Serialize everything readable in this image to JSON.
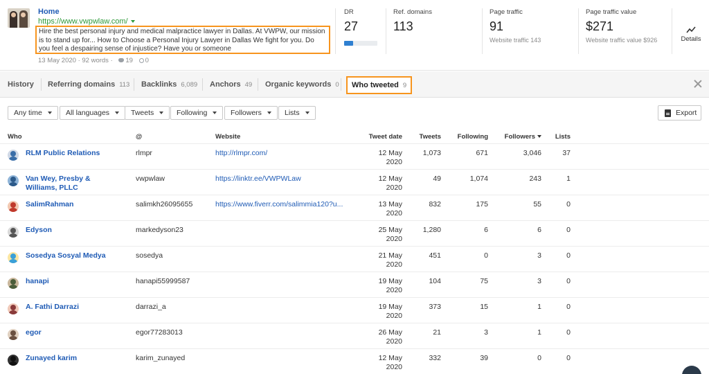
{
  "header": {
    "title": "Home",
    "url": "https://www.vwpwlaw.com/",
    "description": "Hire the best personal injury and medical malpractice lawyer in Dallas. At VWPW, our mission is to stand up for... How to Choose a Personal Injury Lawyer in Dallas We fight for you. Do you feel a despairing sense of injustice? Have you or someone",
    "date": "13 May 2020",
    "words": "· 92 words ·",
    "twitter_count": "19",
    "pinterest_count": "0"
  },
  "metrics": {
    "dr": {
      "label": "DR",
      "value": "27",
      "fill_fraction": 0.27
    },
    "ref_domains": {
      "label": "Ref. domains",
      "value": "113"
    },
    "page_traffic": {
      "label": "Page traffic",
      "value": "91",
      "sub": "Website traffic 143"
    },
    "page_traffic_value": {
      "label": "Page traffic value",
      "value": "$271",
      "sub": "Website traffic value $926"
    },
    "details_label": "Details"
  },
  "tabs": [
    {
      "label": "History",
      "count": ""
    },
    {
      "label": "Referring domains",
      "count": "113"
    },
    {
      "label": "Backlinks",
      "count": "6,089"
    },
    {
      "label": "Anchors",
      "count": "49"
    },
    {
      "label": "Organic keywords",
      "count": "0"
    },
    {
      "label": "Who tweeted",
      "count": "9"
    }
  ],
  "filters": [
    "Any time",
    "All languages",
    "Tweets",
    "Following",
    "Followers",
    "Lists"
  ],
  "export_label": "Export",
  "table": {
    "columns": [
      "Who",
      "@",
      "Website",
      "Tweet date",
      "Tweets",
      "Following",
      "Followers",
      "Lists"
    ],
    "rows": [
      {
        "who": "RLM Public Relations",
        "handle": "rlmpr",
        "website": "http://rlmpr.com/",
        "date1": "12 May",
        "date2": "2020",
        "tweets": "1,073",
        "following": "671",
        "followers": "3,046",
        "lists": "37"
      },
      {
        "who": "Van Wey, Presby & Williams, PLLC",
        "handle": "vwpwlaw",
        "website": "https://linktr.ee/VWPWLaw",
        "date1": "12 May",
        "date2": "2020",
        "tweets": "49",
        "following": "1,074",
        "followers": "243",
        "lists": "1"
      },
      {
        "who": "SalimRahman",
        "handle": "salimkh26095655",
        "website": "https://www.fiverr.com/salimmia120?u...",
        "date1": "13 May",
        "date2": "2020",
        "tweets": "832",
        "following": "175",
        "followers": "55",
        "lists": "0"
      },
      {
        "who": "Edyson",
        "handle": "markedyson23",
        "website": "",
        "date1": "25 May",
        "date2": "2020",
        "tweets": "1,280",
        "following": "6",
        "followers": "6",
        "lists": "0"
      },
      {
        "who": "Sosedya Sosyal Medya",
        "handle": "sosedya",
        "website": "",
        "date1": "21 May",
        "date2": "2020",
        "tweets": "451",
        "following": "0",
        "followers": "3",
        "lists": "0"
      },
      {
        "who": "hanapi",
        "handle": "hanapi55999587",
        "website": "",
        "date1": "19 May",
        "date2": "2020",
        "tweets": "104",
        "following": "75",
        "followers": "3",
        "lists": "0"
      },
      {
        "who": "A. Fathi Darrazi",
        "handle": "darrazi_a",
        "website": "",
        "date1": "19 May",
        "date2": "2020",
        "tweets": "373",
        "following": "15",
        "followers": "1",
        "lists": "0"
      },
      {
        "who": "egor",
        "handle": "egor77283013",
        "website": "",
        "date1": "26 May",
        "date2": "2020",
        "tweets": "21",
        "following": "3",
        "followers": "1",
        "lists": "0"
      },
      {
        "who": "Zunayed karim",
        "handle": "karim_zunayed",
        "website": "",
        "date1": "12 May",
        "date2": "2020",
        "tweets": "332",
        "following": "39",
        "followers": "0",
        "lists": "0"
      }
    ]
  },
  "colors": {
    "link": "#1f5bb5",
    "url_green": "#2e9a3a",
    "highlight_orange": "#f7941d",
    "dr_bar": "#2f80d1"
  },
  "icons": [
    "twitter-icon",
    "pinterest-icon",
    "trend-chart-icon",
    "close-icon",
    "export-doc-icon",
    "dropdown-caret-icon"
  ]
}
